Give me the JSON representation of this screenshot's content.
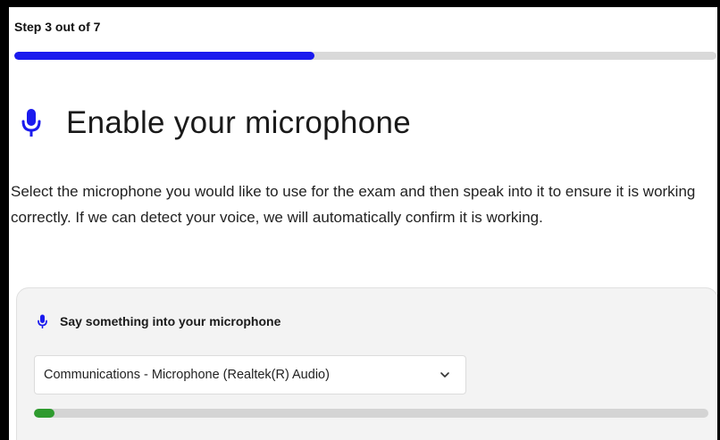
{
  "step": {
    "label": "Step 3 out of 7",
    "current": 3,
    "total": 7,
    "progress_fraction": 0.428
  },
  "heading": {
    "icon": "microphone-icon",
    "title": "Enable your microphone"
  },
  "description": "Select the microphone you would like to use for the exam and then speak into it to ensure it is working correctly. If we can detect your voice, we will automatically confirm it is working.",
  "mic_card": {
    "icon": "microphone-icon",
    "title": "Say something into your microphone",
    "selected_device": "Communications - Microphone (Realtek(R) Audio)",
    "input_level_fraction": 0.03
  },
  "colors": {
    "accent": "#1a1aee",
    "level": "#2e9b2e",
    "track": "#d9d9d9"
  }
}
